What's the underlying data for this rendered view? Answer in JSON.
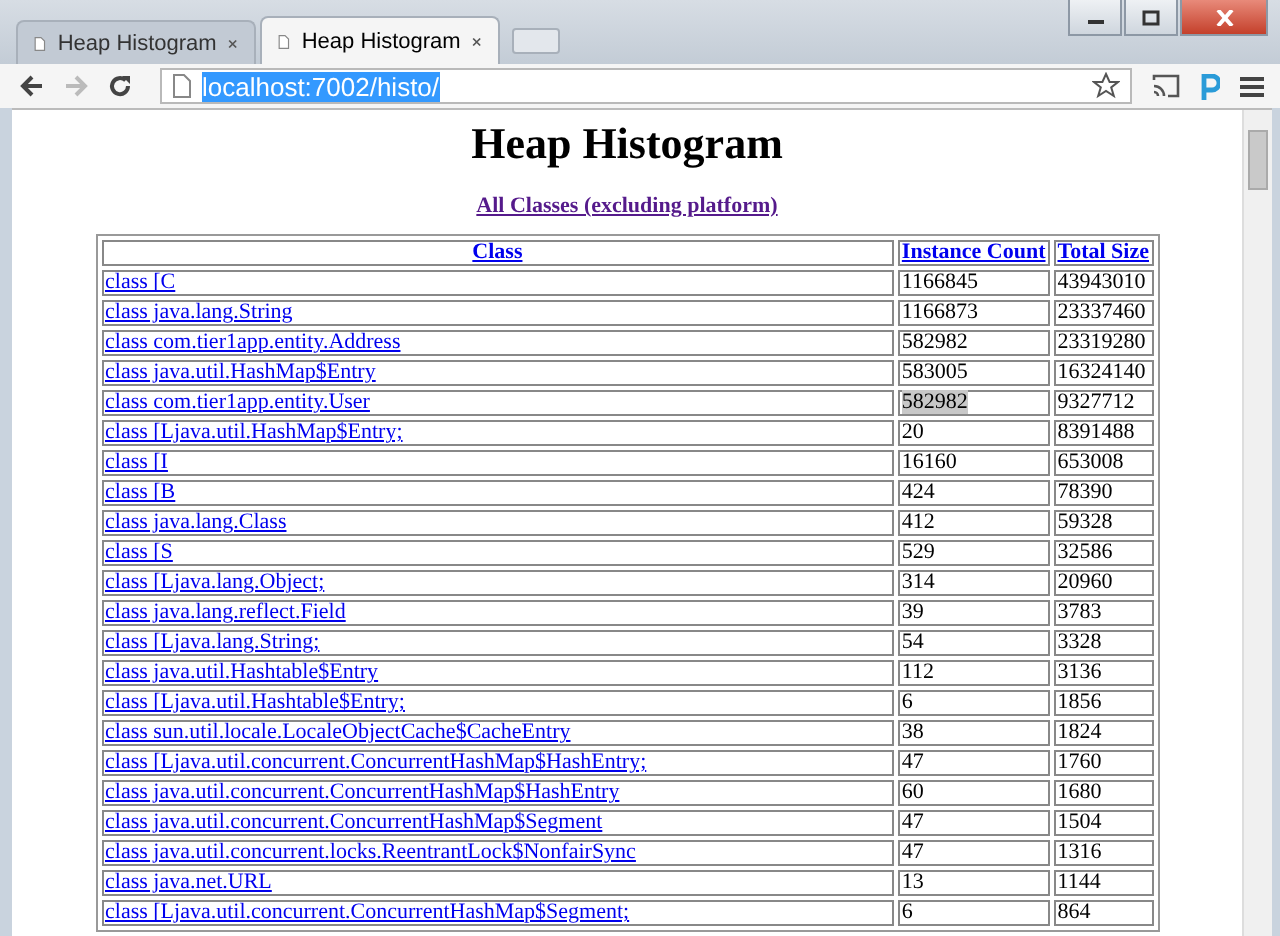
{
  "tabs": [
    {
      "title": "Heap Histogram",
      "selected": false
    },
    {
      "title": "Heap Histogram",
      "selected": true
    }
  ],
  "address_bar": {
    "url": "localhost:7002/histo/",
    "text_selected": true
  },
  "page": {
    "heading": "Heap Histogram",
    "subtitle_link": "All Classes (excluding platform)"
  },
  "table": {
    "columns": [
      "Class",
      "Instance Count",
      "Total Size"
    ],
    "rows": [
      {
        "class": "class [C",
        "count": "1166845",
        "size": "43943010",
        "highlighted": false
      },
      {
        "class": "class java.lang.String",
        "count": "1166873",
        "size": "23337460",
        "highlighted": false
      },
      {
        "class": "class com.tier1app.entity.Address",
        "count": "582982",
        "size": "23319280",
        "highlighted": false
      },
      {
        "class": "class java.util.HashMap$Entry",
        "count": "583005",
        "size": "16324140",
        "highlighted": false
      },
      {
        "class": "class com.tier1app.entity.User",
        "count": "582982",
        "size": "9327712",
        "highlighted": true
      },
      {
        "class": "class [Ljava.util.HashMap$Entry;",
        "count": "20",
        "size": "8391488",
        "highlighted": false
      },
      {
        "class": "class [I",
        "count": "16160",
        "size": "653008",
        "highlighted": false
      },
      {
        "class": "class [B",
        "count": "424",
        "size": "78390",
        "highlighted": false
      },
      {
        "class": "class java.lang.Class",
        "count": "412",
        "size": "59328",
        "highlighted": false
      },
      {
        "class": "class [S",
        "count": "529",
        "size": "32586",
        "highlighted": false
      },
      {
        "class": "class [Ljava.lang.Object;",
        "count": "314",
        "size": "20960",
        "highlighted": false
      },
      {
        "class": "class java.lang.reflect.Field",
        "count": "39",
        "size": "3783",
        "highlighted": false
      },
      {
        "class": "class [Ljava.lang.String;",
        "count": "54",
        "size": "3328",
        "highlighted": false
      },
      {
        "class": "class java.util.Hashtable$Entry",
        "count": "112",
        "size": "3136",
        "highlighted": false
      },
      {
        "class": "class [Ljava.util.Hashtable$Entry;",
        "count": "6",
        "size": "1856",
        "highlighted": false
      },
      {
        "class": "class sun.util.locale.LocaleObjectCache$CacheEntry",
        "count": "38",
        "size": "1824",
        "highlighted": false
      },
      {
        "class": "class [Ljava.util.concurrent.ConcurrentHashMap$HashEntry;",
        "count": "47",
        "size": "1760",
        "highlighted": false
      },
      {
        "class": "class java.util.concurrent.ConcurrentHashMap$HashEntry",
        "count": "60",
        "size": "1680",
        "highlighted": false
      },
      {
        "class": "class java.util.concurrent.ConcurrentHashMap$Segment",
        "count": "47",
        "size": "1504",
        "highlighted": false
      },
      {
        "class": "class java.util.concurrent.locks.ReentrantLock$NonfairSync",
        "count": "47",
        "size": "1316",
        "highlighted": false
      },
      {
        "class": "class java.net.URL",
        "count": "13",
        "size": "1144",
        "highlighted": false
      },
      {
        "class": "class [Ljava.util.concurrent.ConcurrentHashMap$Segment;",
        "count": "6",
        "size": "864",
        "highlighted": false
      }
    ]
  }
}
